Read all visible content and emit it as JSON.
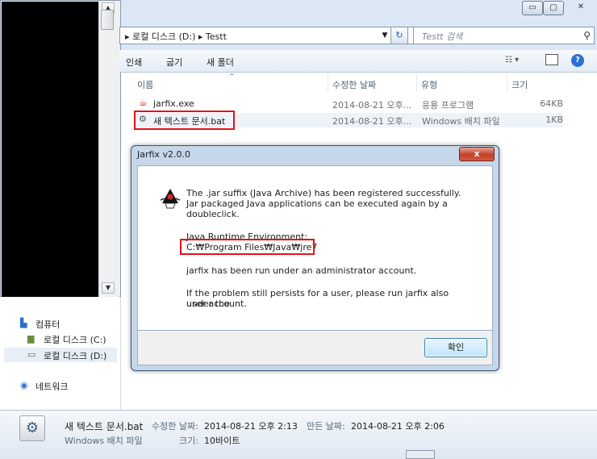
{
  "explorer": {
    "address": {
      "prefix": "▸",
      "drive": "로컬 디스크 (D:)",
      "sep": "▸",
      "folder": "Testt"
    },
    "search_placeholder": "Testt 검색",
    "toolbar": {
      "print": "인쇄",
      "burn": "굽기",
      "new_folder": "새 폴더"
    },
    "columns": {
      "name": "이름",
      "modified": "수정한 날짜",
      "type": "유형",
      "size": "크기"
    },
    "files": [
      {
        "name": "jarfix.exe",
        "modified": "2014-08-21 오후...",
        "type": "응용 프로그램",
        "size": "64KB"
      },
      {
        "name": "새 텍스트 문서.bat",
        "modified": "2014-08-21 오후...",
        "type": "Windows 배치 파일",
        "size": "1KB"
      }
    ],
    "nav": {
      "computer": "컴퓨터",
      "drive_c": "로컬 디스크 (C:)",
      "drive_d": "로컬 디스크 (D:)",
      "network": "네트워크"
    },
    "details": {
      "filename": "새 텍스트 문서.bat",
      "modified_label": "수정한 날짜:",
      "modified_value": "2014-08-21 오후 2:13",
      "created_label": "만든 날짜:",
      "created_value": "2014-08-21 오후 2:06",
      "type": "Windows 배치 파일",
      "size_label": "크기:",
      "size_value": "10바이트"
    }
  },
  "dialog": {
    "title": "Jarfix v2.0.0",
    "close": "x",
    "line1": "The .jar suffix (Java Archive) has been registered successfully.",
    "line2": "Jar packaged Java applications can be executed again by a",
    "line3": "doubleclick.",
    "jre_label": "Java Runtime Environment:",
    "jre_path": "C:₩Program Files₩Java₩jre7",
    "admin_msg": "jarfix has been run under an administrator account.",
    "problem1": "If the problem still persists for a user, please run jarfix also under the",
    "problem2": "user account.",
    "ok": "확인"
  },
  "colors": {
    "highlight_red": "#e0141b",
    "dialog_frame": "#c6d7ea",
    "explorer_bg": "#dbe7f4"
  }
}
